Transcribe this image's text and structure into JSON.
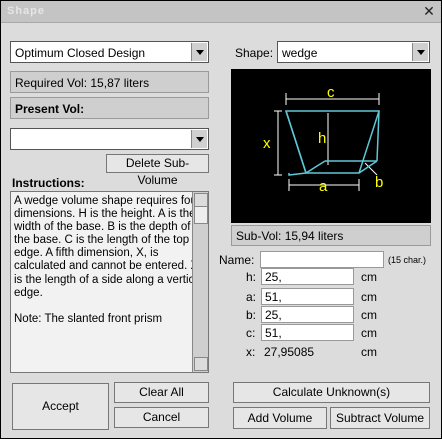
{
  "window": {
    "title": "Shape"
  },
  "design_select": {
    "value": "Optimum Closed Design"
  },
  "required_vol": "Required Vol: 15,87 liters",
  "present_vol_label": "Present Vol:",
  "subvolume_select": {
    "value": ""
  },
  "delete_button": "Delete Sub-Volume",
  "instructions_label": "Instructions:",
  "instructions_text": "A wedge volume shape requires four dimensions. H is the height. A is the width of the base. B is the depth of the base. C is the length of the top edge. A fifth dimension, X, is calculated and cannot be entered. X is the length of a side along a vertical edge.\n\nNote: The slanted front prism",
  "shape_label": "Shape:",
  "shape_select": {
    "value": "wedge"
  },
  "diagram_labels": {
    "c": "c",
    "h": "h",
    "x": "x",
    "a": "a",
    "b": "b"
  },
  "sub_vol": "Sub-Vol: 15,94 liters",
  "name_label": "Name:",
  "name_hint": "(15 char.)",
  "dimensions": [
    {
      "label": "h:",
      "value": "25,",
      "unit": "cm"
    },
    {
      "label": "a:",
      "value": "51,",
      "unit": "cm"
    },
    {
      "label": "b:",
      "value": "25,",
      "unit": "cm"
    },
    {
      "label": "c:",
      "value": "51,",
      "unit": "cm"
    },
    {
      "label": "x:",
      "value": "27,95085",
      "unit": "cm"
    }
  ],
  "buttons": {
    "accept": "Accept",
    "clear_all": "Clear All",
    "cancel": "Cancel",
    "calculate": "Calculate Unknown(s)",
    "add_volume": "Add Volume",
    "subtract_volume": "Subtract Volume"
  },
  "colors": {
    "diagram_bg": "#000000",
    "shape_stroke": "#5fc8d8",
    "label_color": "#ffff00",
    "arrow_color": "#ffffff"
  }
}
